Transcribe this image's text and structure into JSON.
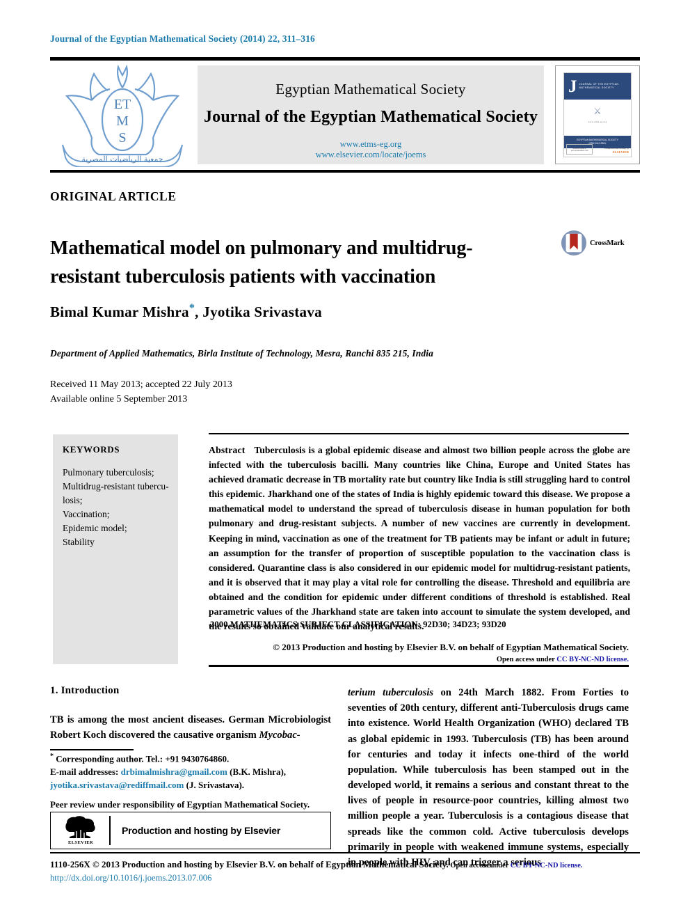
{
  "running_head": "Journal of the Egyptian Mathematical Society (2014) 22, 311–316",
  "masthead": {
    "logo": {
      "letters": [
        "E",
        "T",
        "M",
        "S"
      ],
      "arabic": "جمعية الرياضيات المصرية"
    },
    "society": "Egyptian Mathematical Society",
    "journal": "Journal of the Egyptian Mathematical Society",
    "url1": "www.etms-eg.org",
    "url2": "www.elsevier.com/locate/joems",
    "cover": {
      "letter": "J",
      "band_title": "JOURNAL OF THE EGYPTIAN MATHEMATICAL SOCIETY",
      "url": "www.etms-eg.org",
      "band2": "EGYPTIAN MATHEMATICAL SOCIETY",
      "issn": "ISSN 1110-256X",
      "box_label": "Available online at www.sciencedirect.com",
      "elsevier_top": "Production and hosting by",
      "elsevier": "ELSEVIER"
    }
  },
  "article": {
    "type": "ORIGINAL ARTICLE",
    "title": "Mathematical model on pulmonary and multidrug-resistant tuberculosis patients with vaccination",
    "crossmark_label": "CrossMark",
    "authors": "Bimal Kumar Mishra",
    "authors_rest": ", Jyotika Srivastava",
    "corresponding_marker": "*",
    "affiliation": "Department of Applied Mathematics, Birla Institute of Technology, Mesra, Ranchi 835 215, India",
    "received": "Received 11 May 2013; accepted 22 July 2013",
    "available": "Available online 5 September 2013"
  },
  "keywords": {
    "heading": "KEYWORDS",
    "items": "Pulmonary tuberculosis; Multidrug-resistant tuberculosis; Vaccination; Epidemic model; Stability"
  },
  "abstract": {
    "label": "Abstract",
    "text": "Tuberculosis is a global epidemic disease and almost two billion people across the globe are infected with the tuberculosis bacilli. Many countries like China, Europe and United States has achieved dramatic decrease in TB mortality rate but country like India is still struggling hard to control this epidemic. Jharkhand one of the states of India is highly epidemic toward this disease. We propose a mathematical model to understand the spread of tuberculosis disease in human population for both pulmonary and drug-resistant subjects. A number of new vaccines are currently in development. Keeping in mind, vaccination as one of the treatment for TB patients may be infant or adult in future; an assumption for the transfer of proportion of susceptible population to the vaccination class is considered. Quarantine class is also considered in our epidemic model for multidrug-resistant patients, and it is observed that it may play a vital role for controlling the disease. Threshold and equilibria are obtained and the condition for epidemic under different conditions of threshold is established. Real parametric values of the Jharkhand state are taken into account to simulate the system developed, and the results so obtained validate our analytical results.",
    "msc": "2000 MATHEMATICS SUBJECT CLASSIFICATION:   92D30; 34D23; 93D20",
    "copyright": "© 2013 Production and hosting by Elsevier B.V. on behalf of Egyptian Mathematical Society.",
    "open_access_prefix": "Open access under ",
    "open_access_link": "CC BY-NC-ND license."
  },
  "body": {
    "section_heading": "1. Introduction",
    "left_paragraph": "TB is among the most ancient diseases. German Microbiologist Robert Koch discovered the causative organism Mycobac-",
    "left_italic_tail": "Mycobac-",
    "right_italic_lead": "terium tuberculosis",
    "right_paragraph": " on 24th March 1882. From Forties to seventies of 20th century, different anti-Tuberculosis drugs came into existence. World Health Organization (WHO) declared TB as global epidemic in 1993. Tuberculosis (TB) has been around for centuries and today it infects one-third of the world population. While tuberculosis has been stamped out in the developed world, it remains a serious and constant threat to the lives of people in resource-poor countries, killing almost two million people a year. Tuberculosis is a contagious disease that spreads like the common cold. Active tuberculosis develops primarily in people with weakened immune systems, especially in people with HIV, and can trigger a serious"
  },
  "footnote": {
    "marker": "*",
    "corresponding": " Corresponding author. Tel.: +91 9430764860.",
    "email_label": "E-mail addresses:",
    "email1": "drbimalmishra@gmail.com",
    "email1_name": " (B.K. Mishra), ",
    "email2": "jyotika.srivastava@rediffmail.com",
    "email2_name": " (J. Srivastava).",
    "peer_review": "Peer review under responsibility of Egyptian Mathematical Society."
  },
  "elsevier_box": {
    "logo_word": "ELSEVIER",
    "text": "Production and hosting by Elsevier"
  },
  "footer": {
    "line1": "1110-256X © 2013 Production and hosting by Elsevier B.V. on behalf of Egyptian Mathematical Society.",
    "open_access_prefix": " Open access under ",
    "open_access_link": "CC BY-NC-ND license.",
    "doi": "http://dx.doi.org/10.1016/j.joems.2013.07.006"
  },
  "colors": {
    "link_teal": "#1b7bad",
    "link_blue": "#1a1aa8",
    "cover_navy": "#2c4a7c",
    "keyword_bg": "#e3e3e3",
    "masthead_bg": "#e6e6e6",
    "crossmark_red": "#b5261e",
    "elsevier_orange": "#e87422"
  }
}
